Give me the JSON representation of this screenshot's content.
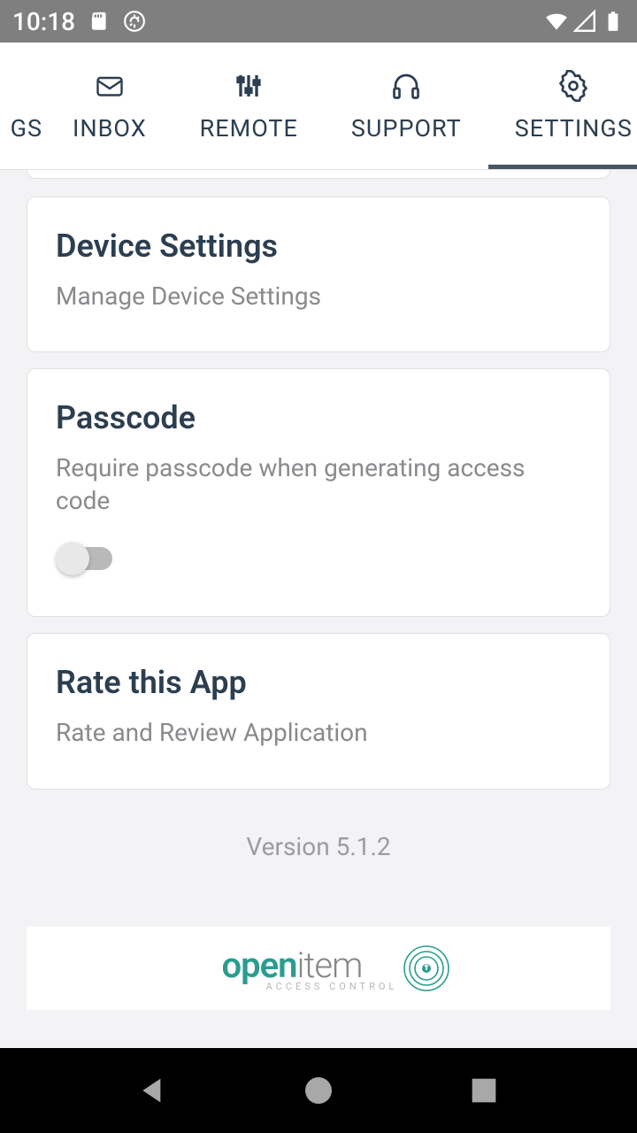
{
  "status": {
    "time": "10:18"
  },
  "tabs": {
    "partial": "GS",
    "items": [
      {
        "label": "INBOX"
      },
      {
        "label": "REMOTE"
      },
      {
        "label": "SUPPORT"
      },
      {
        "label": "SETTINGS"
      }
    ]
  },
  "cards": {
    "device": {
      "title": "Device Settings",
      "subtitle": "Manage Device Settings"
    },
    "passcode": {
      "title": "Passcode",
      "subtitle": "Require passcode when generating access code"
    },
    "rate": {
      "title": "Rate this App",
      "subtitle": "Rate and Review Application"
    }
  },
  "version": "Version 5.1.2",
  "brand": {
    "open": "open",
    "item": "item",
    "sub": "ACCESS CONTROL"
  }
}
